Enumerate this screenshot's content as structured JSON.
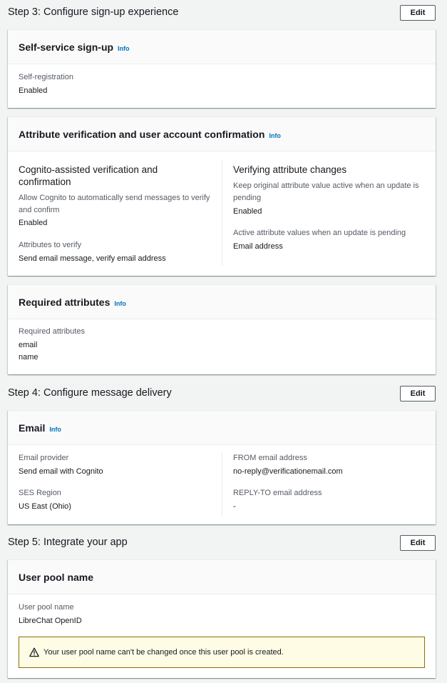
{
  "steps": {
    "step3": {
      "title": "Step 3: Configure sign-up experience",
      "edit_label": "Edit"
    },
    "step4": {
      "title": "Step 4: Configure message delivery",
      "edit_label": "Edit"
    },
    "step5": {
      "title": "Step 5: Integrate your app",
      "edit_label": "Edit"
    }
  },
  "self_service": {
    "title": "Self-service sign-up",
    "info": "Info",
    "label": "Self-registration",
    "value": "Enabled"
  },
  "attr_verification": {
    "title": "Attribute verification and user account confirmation",
    "info": "Info",
    "left": {
      "heading": "Cognito-assisted verification and confirmation",
      "desc": "Allow Cognito to automatically send messages to verify and confirm",
      "desc_value": "Enabled",
      "attrs_label": "Attributes to verify",
      "attrs_value": "Send email message, verify email address"
    },
    "right": {
      "heading": "Verifying attribute changes",
      "desc": "Keep original attribute value active when an update is pending",
      "desc_value": "Enabled",
      "active_label": "Active attribute values when an update is pending",
      "active_value": "Email address"
    }
  },
  "required_attrs": {
    "title": "Required attributes",
    "info": "Info",
    "label": "Required attributes",
    "values": [
      "email",
      "name"
    ]
  },
  "email": {
    "title": "Email",
    "info": "Info",
    "provider_label": "Email provider",
    "provider_value": "Send email with Cognito",
    "region_label": "SES Region",
    "region_value": "US East (Ohio)",
    "from_label": "FROM email address",
    "from_value": "no-reply@verificationemail.com",
    "reply_label": "REPLY-TO email address",
    "reply_value": "-"
  },
  "user_pool": {
    "title": "User pool name",
    "label": "User pool name",
    "value": "LibreChat OpenID",
    "warning": "Your user pool name can't be changed once this user pool is created."
  },
  "icons": {
    "warning": "warning-triangle-icon"
  },
  "colors": {
    "info": "#0073bb",
    "warning_bg": "#fffce6",
    "warning_border": "#8a6d06",
    "page_bg": "#f2f3f3"
  }
}
